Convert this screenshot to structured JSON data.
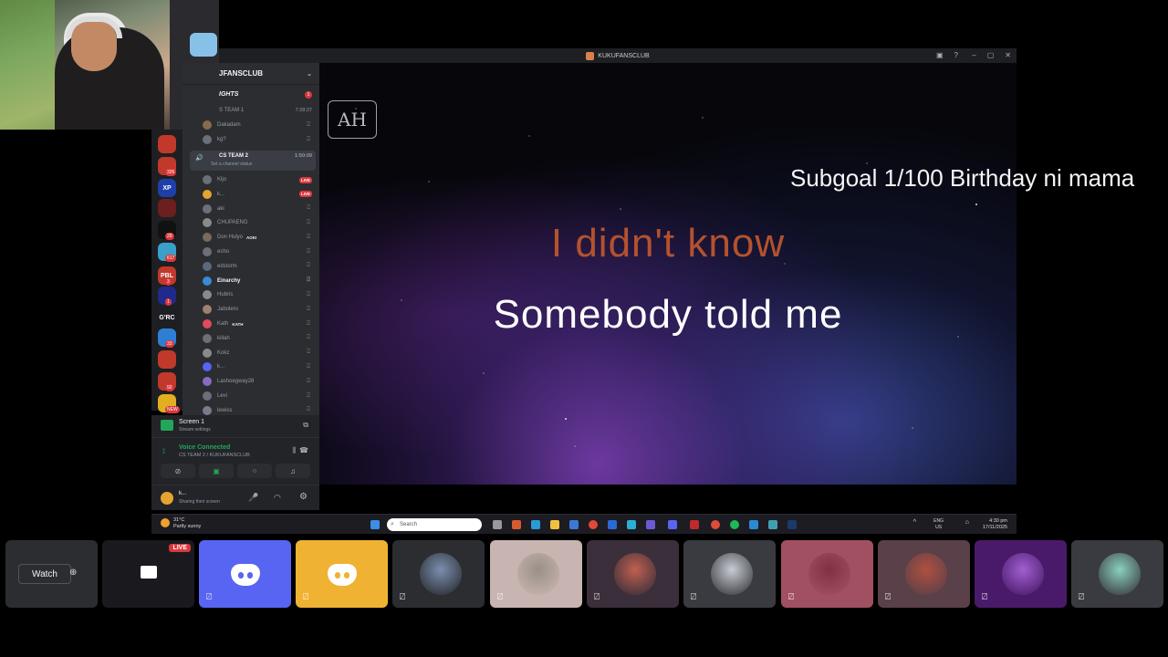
{
  "window": {
    "title": "KUKUFANSCLUB"
  },
  "server_header": {
    "name": "JFANSCLUB"
  },
  "rail": {
    "servers": [
      {
        "label": "",
        "color": "#c0392b",
        "badge": ""
      },
      {
        "label": "",
        "color": "#c0392b",
        "badge": "326"
      },
      {
        "label": "XP",
        "color": "#1f3fa8",
        "badge": ""
      },
      {
        "label": "",
        "color": "#6b1f1f",
        "badge": ""
      },
      {
        "label": "",
        "color": "#111111",
        "badge": "29"
      },
      {
        "label": "",
        "color": "#3aa0c8",
        "badge": "617"
      },
      {
        "label": "PBL",
        "color": "#c0392b",
        "badge": "3"
      },
      {
        "label": "",
        "color": "#1f2a8a",
        "badge": "1"
      },
      {
        "label": "G'RC",
        "color": "#1e1f22",
        "badge": ""
      },
      {
        "label": "",
        "color": "#2d7fd6",
        "badge": "33"
      },
      {
        "label": "",
        "color": "#c0392b",
        "badge": ""
      },
      {
        "label": "",
        "color": "#c0392b",
        "badge": "92"
      },
      {
        "label": "",
        "color": "#e0b020",
        "badge": "NEW"
      }
    ]
  },
  "channels": {
    "category": "IGHTS",
    "category_badge": "1",
    "team1": {
      "name": "S TEAM 1",
      "time": "7:28:27"
    },
    "team1_members": [
      "Dakadam",
      "kg?"
    ],
    "team2": {
      "name": "CS TEAM 2",
      "time": "1:50:09",
      "status": "Set a channel status"
    },
    "team2_members": [
      {
        "name": "Kljo",
        "tag": "",
        "live": true
      },
      {
        "name": "k...",
        "tag": "",
        "live": true
      },
      {
        "name": "aki",
        "tag": "",
        "live": false
      },
      {
        "name": "CHUPAENG",
        "tag": "",
        "live": false
      },
      {
        "name": "Don Hulyo",
        "tag": "AOKI",
        "live": false
      },
      {
        "name": "echo",
        "tag": "",
        "live": false
      },
      {
        "name": "edstorm",
        "tag": "",
        "live": false
      },
      {
        "name": "Einarchy",
        "tag": "",
        "live": false
      },
      {
        "name": "Hubris",
        "tag": "",
        "live": false
      },
      {
        "name": "Jabolero",
        "tag": "",
        "live": false
      },
      {
        "name": "Kath",
        "tag": "KATH",
        "live": false
      },
      {
        "name": "killah",
        "tag": "",
        "live": false
      },
      {
        "name": "Kokz",
        "tag": "",
        "live": false
      },
      {
        "name": "k...",
        "tag": "",
        "live": false
      },
      {
        "name": "Lashoegway28",
        "tag": "",
        "live": false
      },
      {
        "name": "Levi",
        "tag": "",
        "live": false
      },
      {
        "name": "lewiss",
        "tag": "",
        "live": false
      }
    ],
    "live_label": "LIVE"
  },
  "screen_panel": {
    "title": "Screen 1",
    "subtitle": "Stream settings"
  },
  "voice_panel": {
    "status": "Voice Connected",
    "location": "CS TEAM 2 / KUKUFANSCLUB"
  },
  "user_panel": {
    "name": "k...",
    "status": "Sharing their screen"
  },
  "video": {
    "logo": "AH",
    "subgoal": "Subgoal 1/100 Birthday ni mama",
    "lyric_prev": "I didn't know",
    "lyric_current": "Somebody told me"
  },
  "taskbar": {
    "weather_temp": "31°C",
    "weather_desc": "Partly sunny",
    "search_placeholder": "Search",
    "lang": "ENG",
    "region": "US",
    "time": "4:30 pm",
    "date": "17/11/2025"
  },
  "strip": {
    "watch_label": "Watch",
    "live_label": "LIVE",
    "tiles": [
      {
        "type": "watch",
        "bg": "#2b2d31"
      },
      {
        "type": "stream",
        "bg": "#1a1a1e"
      },
      {
        "type": "discord",
        "bg": "#5865f2"
      },
      {
        "type": "discord",
        "bg": "#f0b232"
      },
      {
        "type": "avatar",
        "bg": "#2b2d31",
        "accent": "#7a8fb0"
      },
      {
        "type": "avatar",
        "bg": "#c8b4b0",
        "accent": "#9a8f88"
      },
      {
        "type": "avatar",
        "bg": "#3a2f3a",
        "accent": "#c06050"
      },
      {
        "type": "avatar",
        "bg": "#3a3b40",
        "accent": "#c8ccd4"
      },
      {
        "type": "avatar",
        "bg": "#a05060",
        "accent": "#803040"
      },
      {
        "type": "avatar",
        "bg": "#5a4048",
        "accent": "#b05040"
      },
      {
        "type": "avatar",
        "bg": "#4a1a6a",
        "accent": "#a060d0"
      },
      {
        "type": "avatar",
        "bg": "#3a3b40",
        "accent": "#8ad0c0"
      }
    ]
  },
  "colors": {
    "accent": "#5865f2",
    "live": "#da373c",
    "connected": "#23a55a"
  }
}
